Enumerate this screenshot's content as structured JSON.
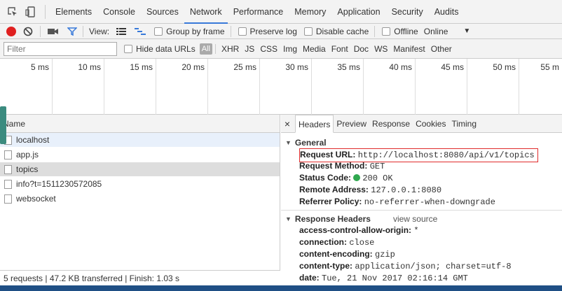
{
  "tabs": [
    "Elements",
    "Console",
    "Sources",
    "Network",
    "Performance",
    "Memory",
    "Application",
    "Security",
    "Audits"
  ],
  "toolbar": {
    "view_label": "View:",
    "group_by_frame": "Group by frame",
    "preserve_log": "Preserve log",
    "disable_cache": "Disable cache",
    "offline": "Offline",
    "throttle": "Online"
  },
  "filterbar": {
    "placeholder": "Filter",
    "hide_data_urls": "Hide data URLs",
    "types": [
      "All",
      "XHR",
      "JS",
      "CSS",
      "Img",
      "Media",
      "Font",
      "Doc",
      "WS",
      "Manifest",
      "Other"
    ]
  },
  "timeline": {
    "ticks": [
      "5 ms",
      "10 ms",
      "15 ms",
      "20 ms",
      "25 ms",
      "30 ms",
      "35 ms",
      "40 ms",
      "45 ms",
      "50 ms",
      "55 m"
    ]
  },
  "requests": {
    "header": "Name",
    "items": [
      "localhost",
      "app.js",
      "topics",
      "info?t=1511230572085",
      "websocket"
    ],
    "status": "5 requests | 47.2 KB transferred | Finish: 1.03 s"
  },
  "details": {
    "close": "×",
    "tabs": [
      "Headers",
      "Preview",
      "Response",
      "Cookies",
      "Timing"
    ],
    "general_title": "General",
    "general": [
      {
        "k": "Request URL:",
        "v": "http://localhost:8080/api/v1/topics"
      },
      {
        "k": "Request Method:",
        "v": "GET"
      },
      {
        "k": "Status Code:",
        "v": "200 OK"
      },
      {
        "k": "Remote Address:",
        "v": "127.0.0.1:8080"
      },
      {
        "k": "Referrer Policy:",
        "v": "no-referrer-when-downgrade"
      }
    ],
    "response_title": "Response Headers",
    "view_source": "view source",
    "response": [
      {
        "k": "access-control-allow-origin:",
        "v": "*"
      },
      {
        "k": "connection:",
        "v": "close"
      },
      {
        "k": "content-encoding:",
        "v": "gzip"
      },
      {
        "k": "content-type:",
        "v": "application/json; charset=utf-8"
      },
      {
        "k": "date:",
        "v": "Tue, 21 Nov 2017 02:16:14 GMT"
      }
    ]
  },
  "colors": {
    "record": "#e02020",
    "accent": "#3879d9",
    "status_ok": "#2fa84f"
  }
}
